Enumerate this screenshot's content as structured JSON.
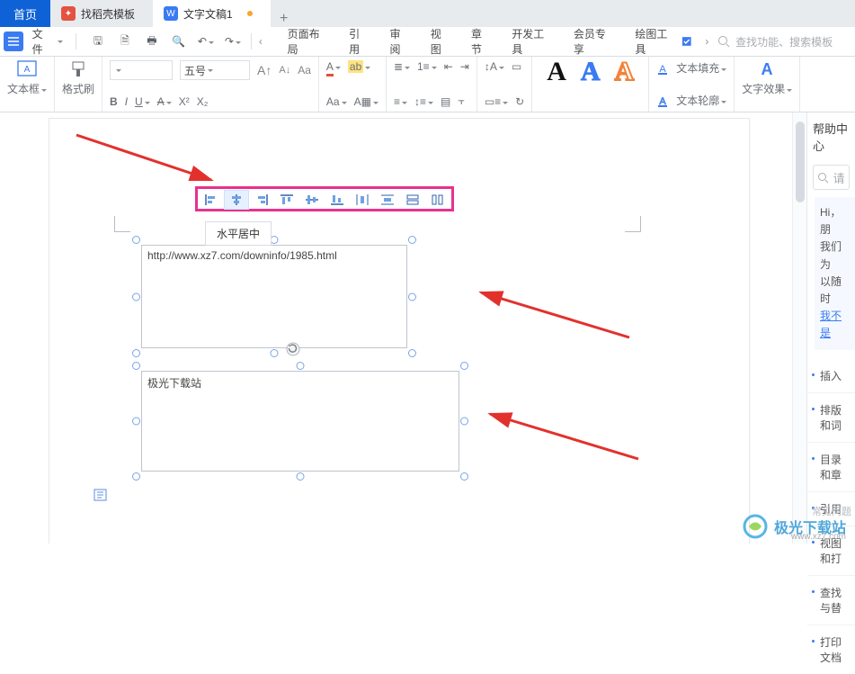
{
  "tabs": {
    "home": "首页",
    "daoke": "找稻壳模板",
    "current": "文字文稿1",
    "add": "+"
  },
  "menubar": {
    "file": "文件",
    "ribbon_tabs": [
      "页面布局",
      "引用",
      "审阅",
      "视图",
      "章节",
      "开发工具",
      "会员专享"
    ],
    "context_tab": "绘图工具",
    "search_ph": "查找功能、搜索模板"
  },
  "ribbon": {
    "textbox": "文本框",
    "format_painter": "格式刷",
    "font_size": "五号",
    "text_fill": "文本填充",
    "text_outline": "文本轮廓",
    "text_effect": "文字效果"
  },
  "float_toolbar": {
    "tooltip": "水平居中"
  },
  "shapes": {
    "box1_text": "http://www.xz7.com/downinfo/1985.html",
    "box2_text": "极光下载站"
  },
  "rightpane": {
    "title": "帮助中心",
    "search_ph": "请",
    "greet": "Hi，朋",
    "line2": "我们为",
    "line3": "以随时",
    "link": "我不是",
    "items": [
      "插入",
      "排版和词",
      "目录和章",
      "引用",
      "视图和打",
      "查找与替",
      "打印文档"
    ]
  },
  "watermark": {
    "brand": "极光下载站",
    "faq": "常见问题"
  }
}
